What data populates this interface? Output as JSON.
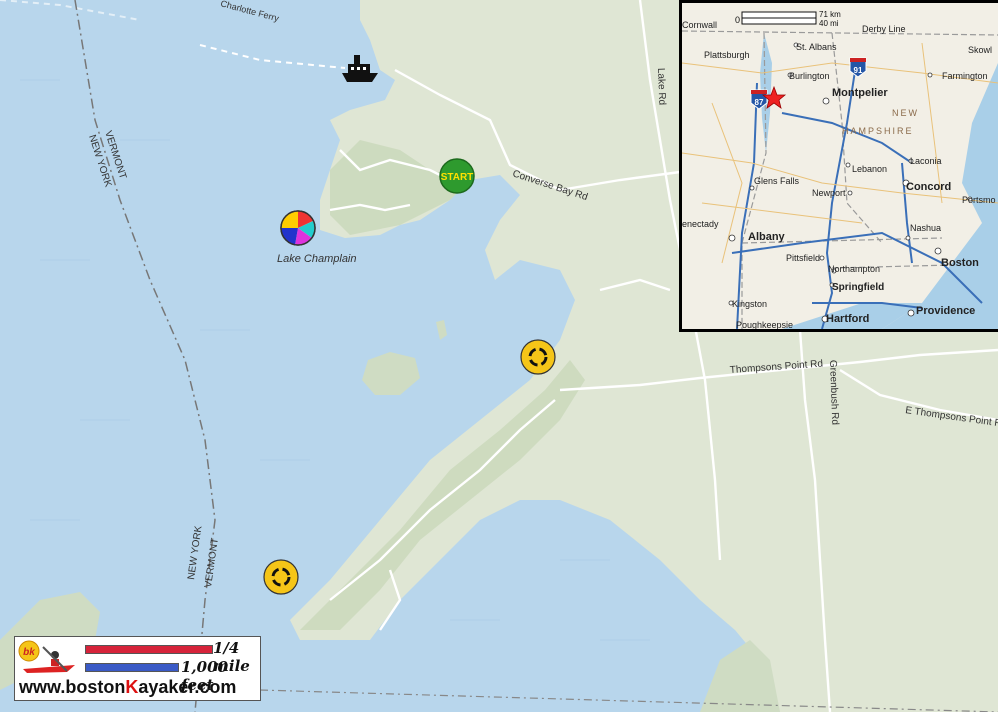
{
  "map": {
    "water_label": "Lake Champlain",
    "roads": {
      "converse_bay": "Converse Bay Rd",
      "thompsons_point": "Thompsons Point Rd",
      "e_thompsons_point": "E Thompsons Point Rd",
      "greenbush": "Greenbush Rd",
      "lake": "Lake Rd",
      "ferry": "Charlotte Ferry"
    },
    "state_border": {
      "north_top": "VERMONT",
      "north_bottom": "NEW YORK",
      "south_top": "NEW YORK",
      "south_bottom": "VERMONT"
    },
    "markers": {
      "start": "START"
    },
    "colors": {
      "water": "#b8d6ec",
      "land": "#dfe6d4",
      "start": "#2e9a2e",
      "ferry": "#111111",
      "kayak_marker": "#f5c518"
    }
  },
  "inset": {
    "scale_km": "71 km",
    "scale_mi": "40 mi",
    "scale_zero": "0",
    "interstates": {
      "i91": "91",
      "i87": "87"
    },
    "cities": {
      "cornwall": "Cornwall",
      "plattsburgh": "Plattsburgh",
      "st_albans": "St. Albans",
      "derby_line": "Derby Line",
      "burlington": "Burlington",
      "slow": "Skowl",
      "farmington": "Farmington",
      "montpelier": "Montpelier",
      "new": "NEW",
      "hampshire": "HAMPSHIRE",
      "lebanon": "Lebanon",
      "laconia": "Laconia",
      "glens_falls": "Glens Falls",
      "newport": "Newport",
      "concord": "Concord",
      "portsmouth": "Portsmo",
      "schenectady": "enectady",
      "nashua": "Nashua",
      "albany": "Albany",
      "pittsfield": "Pittsfield",
      "northampton": "Northampton",
      "boston": "Boston",
      "springfield": "Springfield",
      "kingston": "Kingston",
      "providence": "Providence",
      "poughkeepsie": "Poughkeepsie",
      "hartford": "Hartford"
    }
  },
  "brand": {
    "quarter_mile": "1/4 mile",
    "feet": "1,000 feet",
    "url_prefix": "www.boston",
    "url_k": "K",
    "url_suffix": "ayaker.com",
    "logo_text": "bk"
  }
}
